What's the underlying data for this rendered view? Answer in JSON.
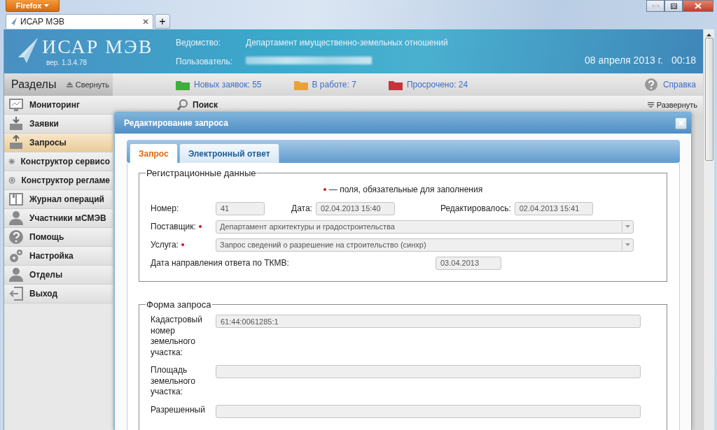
{
  "browser": {
    "menu_button": "Firefox",
    "tab": {
      "title": "ИСАР МЭВ"
    },
    "new_tab": "+"
  },
  "header": {
    "logo": "ИСАР МЭВ",
    "version": "вер. 1.3.4.78",
    "agency_label": "Ведомство:",
    "agency": "Департамент имущественно-земельных отношений",
    "user_label": "Пользователь:",
    "date": "08 апреля 2013 г.",
    "time": "00:18"
  },
  "sidebar": {
    "title": "Разделы",
    "collapse": "Свернуть",
    "items": [
      {
        "label": "Мониторинг",
        "kind": "monitor",
        "selected": false
      },
      {
        "label": "Заявки",
        "kind": "inbox",
        "selected": false
      },
      {
        "label": "Запросы",
        "kind": "outbox",
        "selected": true
      },
      {
        "label": "Конструктор сервисо",
        "kind": "gear",
        "selected": false
      },
      {
        "label": "Конструктор регламе",
        "kind": "cycle",
        "selected": false
      },
      {
        "label": "Журнал операций",
        "kind": "book",
        "selected": false
      },
      {
        "label": "Участники мСМЭВ",
        "kind": "person",
        "selected": false
      },
      {
        "label": "Помощь",
        "kind": "help",
        "selected": false
      },
      {
        "label": "Настройка",
        "kind": "gears",
        "selected": false
      },
      {
        "label": "Отделы",
        "kind": "person",
        "selected": false
      },
      {
        "label": "Выход",
        "kind": "exit",
        "selected": false
      }
    ]
  },
  "status_links": [
    {
      "label": "Новых заявок: 55",
      "color": "#3fae3f"
    },
    {
      "label": "В работе: 7",
      "color": "#e9a23b"
    },
    {
      "label": "Просрочено: 24",
      "color": "#c8323a"
    }
  ],
  "help_link": "Справка",
  "search_panel": {
    "title": "Поиск",
    "expand": "Развернуть"
  },
  "dialog": {
    "title": "Редактирование запроса",
    "tabs": [
      {
        "label": "Запрос",
        "selected": true
      },
      {
        "label": "Электронный ответ",
        "selected": false
      }
    ],
    "registration": {
      "legend": "Регистрационные данные",
      "required_note": "— поля, обязательные для заполнения",
      "number_label": "Номер:",
      "number": "41",
      "date_label": "Дата:",
      "date": "02.04.2013 15:40",
      "edited_label": "Редактировалось:",
      "edited": "02.04.2013 15:41",
      "selects": [
        {
          "label": "Поставщик:",
          "required": true,
          "value": "Департамент архитектуры и градостроительства"
        },
        {
          "label": "Услуга:",
          "required": true,
          "value": "Запрос сведений о разрешение на строительство (синхр)"
        }
      ],
      "reply_date_label": "Дата направления ответа по ТКМВ:",
      "reply_date": "03.04.2013"
    },
    "request_form": {
      "legend": "Форма запроса",
      "fields": [
        {
          "label": "Кадастровый номер земельного участка:",
          "value": "61:44:0061285:1"
        },
        {
          "label": "Площадь земельного участка:"
        },
        {
          "label": "Разрешенный"
        }
      ]
    }
  }
}
